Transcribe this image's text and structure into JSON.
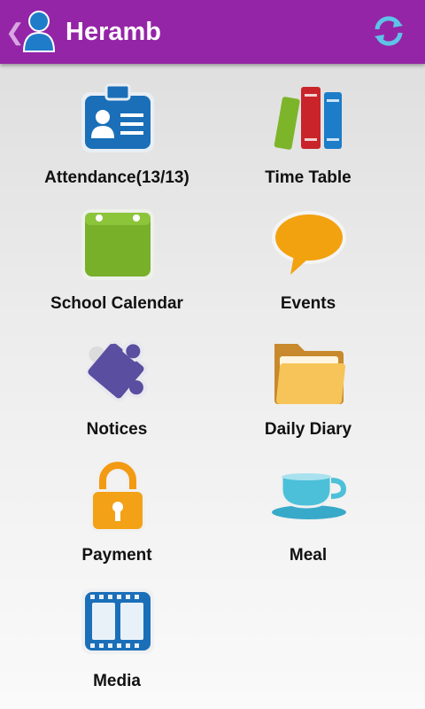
{
  "header": {
    "title": "Heramb",
    "background": "#9425a6"
  },
  "tiles": [
    {
      "label": "Attendance(13/13)",
      "icon": "id-card-icon"
    },
    {
      "label": "Time Table",
      "icon": "books-icon"
    },
    {
      "label": "School Calendar",
      "icon": "calendar-icon"
    },
    {
      "label": "Events",
      "icon": "speech-bubble-icon"
    },
    {
      "label": "Notices",
      "icon": "puzzle-icon"
    },
    {
      "label": "Daily Diary",
      "icon": "folder-icon"
    },
    {
      "label": "Payment",
      "icon": "padlock-icon"
    },
    {
      "label": "Meal",
      "icon": "cup-icon"
    },
    {
      "label": "Media",
      "icon": "film-icon"
    }
  ]
}
